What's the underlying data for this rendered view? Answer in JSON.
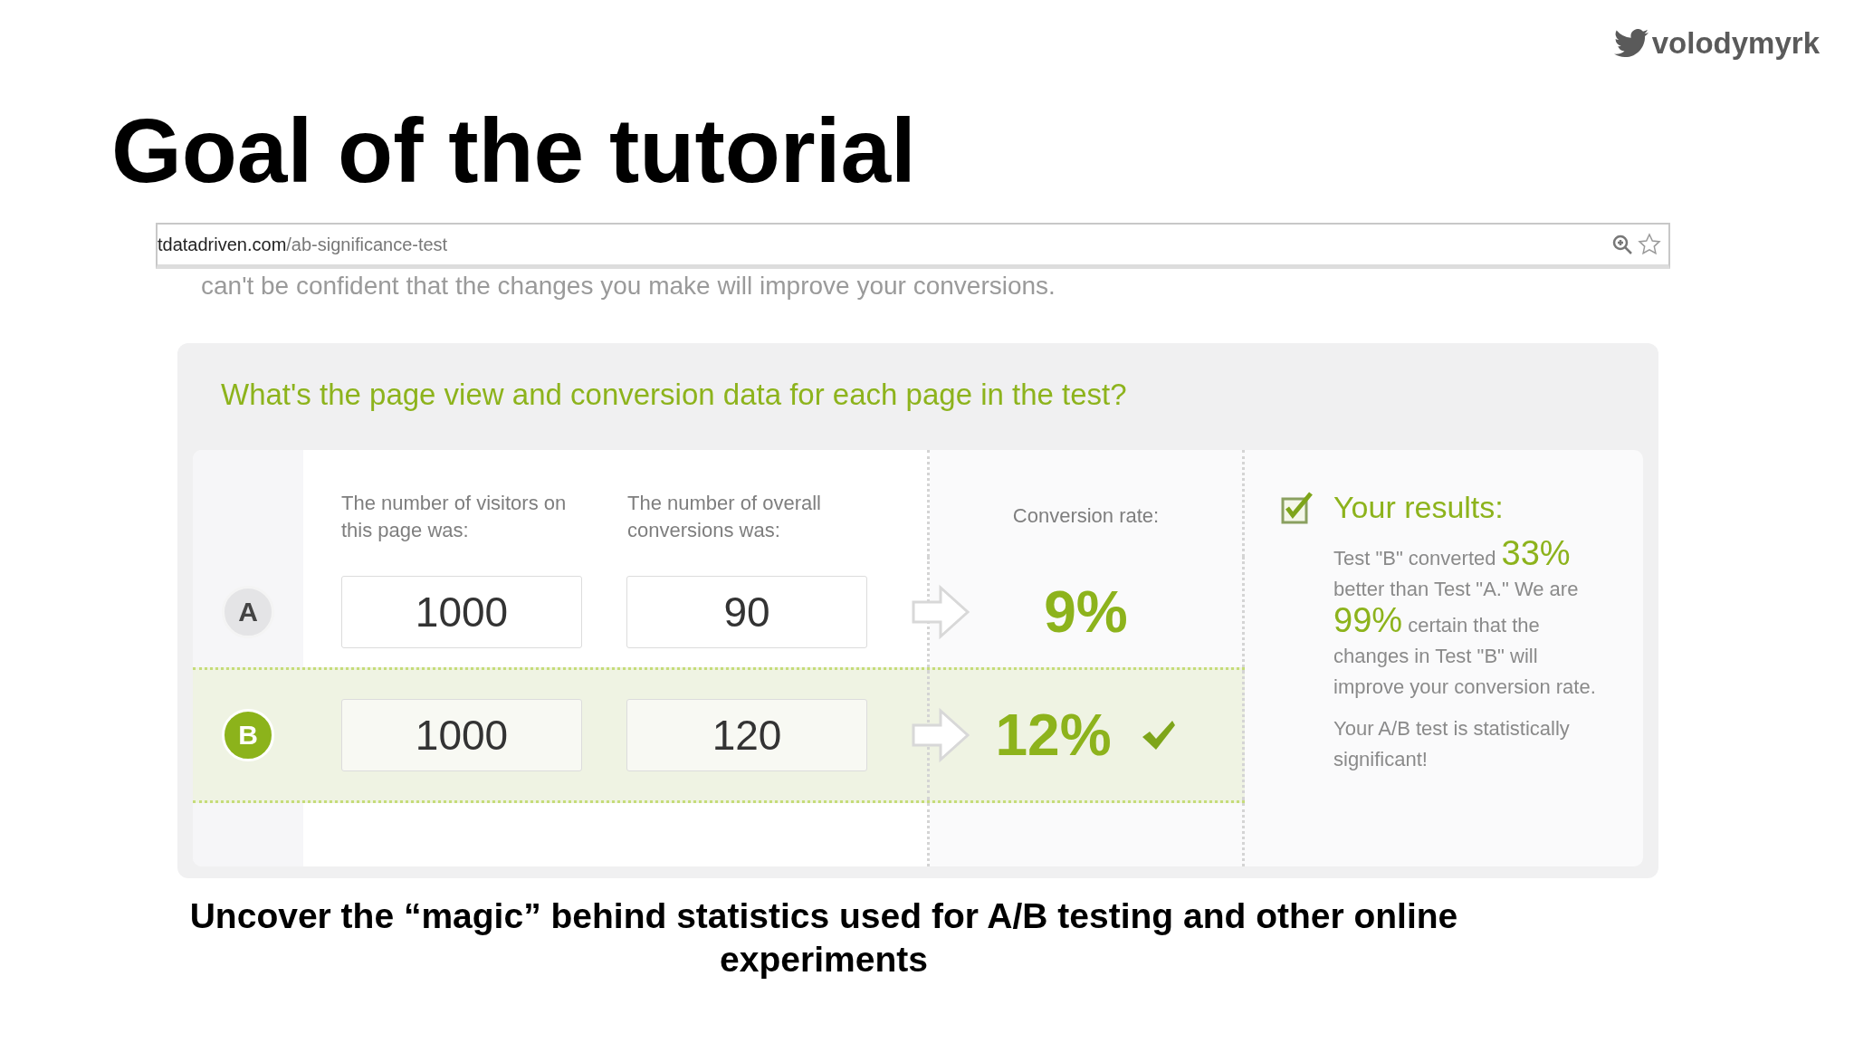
{
  "handle": "volodymyrk",
  "title": "Goal of the tutorial",
  "browser": {
    "url_host": "tdatadriven.com",
    "url_path": "/ab-significance-test"
  },
  "intro_text": "can't be confident that the changes you make will improve your conversions.",
  "calculator": {
    "question": "What's the page view and conversion data for each page in the test?",
    "columns": [
      "The number of visitors on this page was:",
      "The number of overall conversions was:",
      "Conversion rate:"
    ],
    "rows": [
      {
        "label": "A",
        "visitors": "1000",
        "conversions": "90",
        "rate": "9%",
        "selected": false
      },
      {
        "label": "B",
        "visitors": "1000",
        "conversions": "120",
        "rate": "12%",
        "selected": true
      }
    ],
    "results": {
      "heading": "Your results:",
      "checked": true,
      "paragraph": [
        {
          "kind": "plain",
          "text": "Test \"B\" converted "
        },
        {
          "kind": "highlight",
          "text": "33%"
        },
        {
          "kind": "plain",
          "text": " better than Test \"A.\" We are "
        },
        {
          "kind": "highlight",
          "text": "99%"
        },
        {
          "kind": "plain",
          "text": " certain that the changes in Test \"B\" will improve your conversion rate."
        }
      ],
      "conclusion": "Your A/B test is statistically significant!"
    }
  },
  "caption": "Uncover the “magic” behind statistics used for A/B testing and other online experiments"
}
